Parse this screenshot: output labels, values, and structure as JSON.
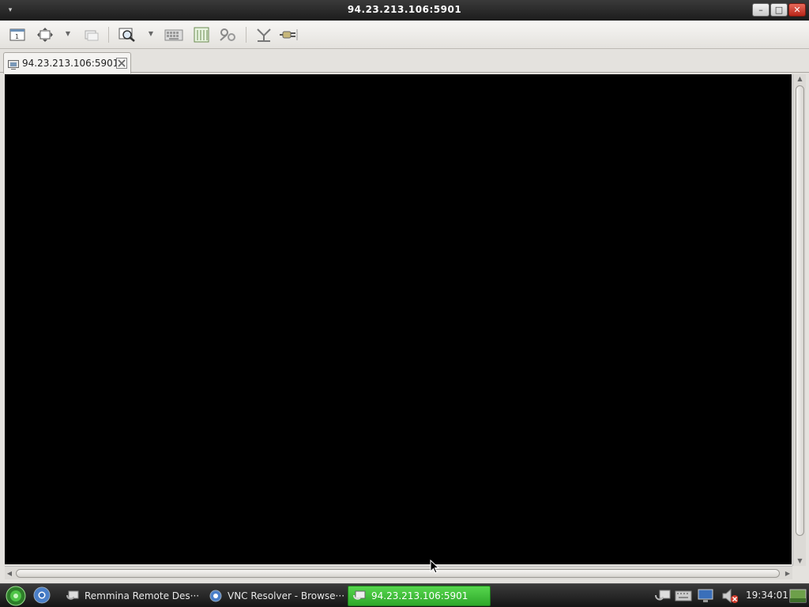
{
  "window": {
    "title": "94.23.213.106:5901",
    "menu_glyph": "▾",
    "minimize_glyph": "–",
    "maximize_glyph": "□",
    "close_glyph": "✕"
  },
  "toolbar": {
    "icons": [
      "fullscreen-icon",
      "auto-fit-icon",
      "scaled-window-icon",
      "minimize-tab-icon",
      "zoom-icon",
      "grab-keyboard-icon",
      "preferences-icon",
      "tools-icon",
      "screenshot-icon",
      "disconnect-icon"
    ]
  },
  "tab": {
    "label": "94.23.213.106:5901"
  },
  "taskbar": {
    "tasks": [
      {
        "label": "Remmina Remote Des···",
        "icon": "remmina-icon"
      },
      {
        "label": "VNC Resolver - Browse···",
        "icon": "chromium-icon"
      },
      {
        "label": "94.23.213.106:5901",
        "icon": "remmina-icon"
      }
    ],
    "clock": "19:34:01"
  },
  "colors": {
    "active_task": "#3fbf38",
    "close_button": "#c0392b",
    "titlebar": "#2a2a2a",
    "viewport": "#000000"
  }
}
